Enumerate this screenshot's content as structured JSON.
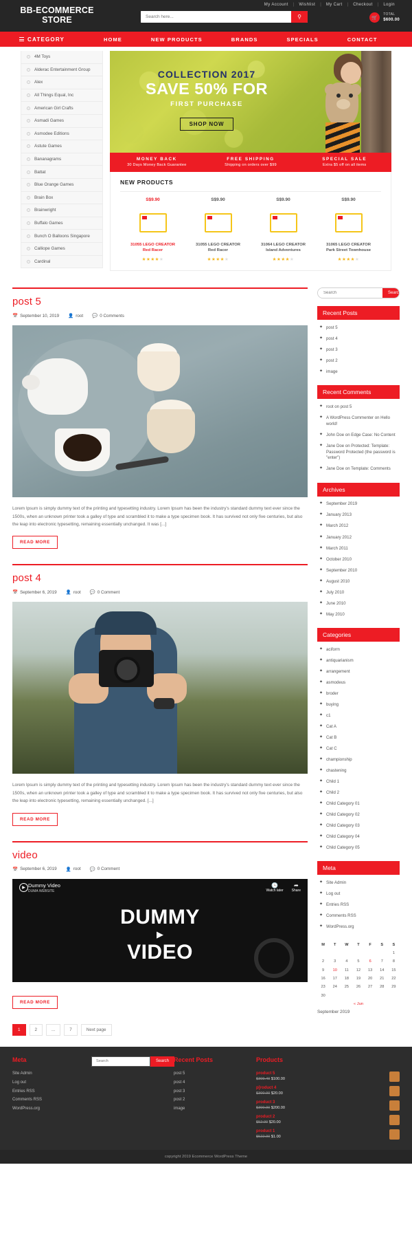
{
  "header": {
    "brand": "BB-ECOMMERCE STORE",
    "top_links": [
      "My Account",
      "Wishlist",
      "My Cart",
      "Checkout",
      "Login"
    ],
    "search_placeholder": "Search here...",
    "search_value": "",
    "search_icon": "search-icon",
    "cart_icon": "cart-icon",
    "cart_label": "TOTAL",
    "cart_total": "$600.00"
  },
  "nav": {
    "category_label": "CATEGORY",
    "items": [
      "HOME",
      "NEW PRODUCTS",
      "BRANDS",
      "SPECIALS",
      "CONTACT"
    ]
  },
  "categories": [
    "4M Toys",
    "Alderac Entertainment Group",
    "Alex",
    "All Things Equal, Inc",
    "American Girl Crafts",
    "Asmadi Games",
    "Asmodee Editions",
    "Astute Games",
    "Bananagrams",
    "Battat",
    "Blue Orange Games",
    "Brain Box",
    "Brainwright",
    "Buffalo Games",
    "Bunch O Balloons Singapore",
    "Calliope Games",
    "Cardinal"
  ],
  "banner": {
    "line1": "COLLECTION 2017",
    "line2": "SAVE 50% FOR",
    "line3": "FIRST PURCHASE",
    "cta": "SHOP NOW"
  },
  "promos": [
    {
      "title": "MONEY BACK",
      "sub": "30 Days Money Back Guarantee"
    },
    {
      "title": "FREE SHIPPING",
      "sub": "Shipping on orders over $99"
    },
    {
      "title": "SPECIAL SALE",
      "sub": "Extra $5 off on all items"
    }
  ],
  "new_products": {
    "heading": "NEW PRODUCTS",
    "items": [
      {
        "price": "S$9.90",
        "sale": true,
        "name_line1": "31055 LEGO CREATOR",
        "name_line2": "Red Racer",
        "rating": 4
      },
      {
        "price": "S$9.90",
        "sale": false,
        "name_line1": "31055 LEGO CREATOR",
        "name_line2": "Red Racer",
        "rating": 4
      },
      {
        "price": "S$9.90",
        "sale": false,
        "name_line1": "31064 LEGO CREATOR",
        "name_line2": "Island Adventures",
        "rating": 4
      },
      {
        "price": "S$9.90",
        "sale": false,
        "name_line1": "31065 LEGO CREATOR",
        "name_line2": "Park Street Townhouse",
        "rating": 4
      }
    ]
  },
  "posts": [
    {
      "title": "post 5",
      "date": "September 10, 2019",
      "author": "root",
      "comments": "0 Comments",
      "excerpt": "Lorem Ipsum is simply dummy text of the printing and typesetting industry. Lorem Ipsum has been the industry's standard dummy text ever since the 1500s, when an unknown printer took a galley of type and scrambled it to make a type specimen book. It has survived not only five centuries, but also the leap into electronic typesetting, remaining essentially unchanged. It was [...]",
      "read_more": "READ MORE"
    },
    {
      "title": "post 4",
      "date": "September 6, 2019",
      "author": "root",
      "comments": "0 Comment",
      "excerpt": "Lorem Ipsum is simply dummy text of the printing and typesetting industry. Lorem Ipsum has been the industry's standard dummy text ever since the 1500s, when an unknown printer took a galley of type and scrambled it to make a type specimen book. It has survived not only five centuries, but also the leap into electronic typesetting, remaining essentially unchanged. [...]",
      "read_more": "READ MORE"
    },
    {
      "title": "video",
      "date": "September 6, 2019",
      "author": "root",
      "comments": "0 Comment",
      "read_more": "READ MORE"
    }
  ],
  "video": {
    "title": "Dummy Video",
    "channel": "DUMA WEBSITE",
    "watch_later": "Watch later",
    "share": "Share",
    "overlay_line1": "DUMMY",
    "overlay_line2": "VIDEO"
  },
  "pagination": [
    "1",
    "2",
    "...",
    "7",
    "Next page"
  ],
  "sidebar": {
    "search_placeholder": "Search",
    "search_button": "Search",
    "recent_posts": {
      "title": "Recent Posts",
      "items": [
        "post 5",
        "post 4",
        "post 3",
        "post 2",
        "image"
      ]
    },
    "recent_comments": {
      "title": "Recent Comments",
      "items": [
        "root on post 5",
        "A WordPress Commenter on Hello world!",
        "John Doe on Edge Case: No Content",
        "Jane Doe on Protected: Template: Password Protected (the password is \"enter\")",
        "Jane Doe on Template: Comments"
      ]
    },
    "archives": {
      "title": "Archives",
      "items": [
        "September 2019",
        "January 2013",
        "March 2012",
        "January 2012",
        "March 2011",
        "October 2010",
        "September 2010",
        "August 2010",
        "July 2010",
        "June 2010",
        "May 2010"
      ]
    },
    "categories": {
      "title": "Categories",
      "items": [
        "aciform",
        "antiquarianism",
        "arrangement",
        "asmodeus",
        "broder",
        "buying",
        "c1",
        "Cat A",
        "Cat B",
        "Cat C",
        "championship",
        "chastening",
        "Child 1",
        "Child 2",
        "Child Category 01",
        "Child Category 02",
        "Child Category 03",
        "Child Category 04",
        "Child Category 05"
      ]
    },
    "meta": {
      "title": "Meta",
      "items": [
        "Site Admin",
        "Log out",
        "Entries RSS",
        "Comments RSS",
        "WordPress.org"
      ]
    },
    "calendar": {
      "weekdays": [
        "M",
        "T",
        "W",
        "T",
        "F",
        "S",
        "S"
      ],
      "weeks": [
        [
          "",
          "",
          "",
          "",
          "",
          "",
          "1"
        ],
        [
          "2",
          "3",
          "4",
          "5",
          "6",
          "7",
          "8"
        ],
        [
          "9",
          "10",
          "11",
          "12",
          "13",
          "14",
          "15"
        ],
        [
          "16",
          "17",
          "18",
          "19",
          "20",
          "21",
          "22"
        ],
        [
          "23",
          "24",
          "25",
          "26",
          "27",
          "28",
          "29"
        ],
        [
          "30",
          "",
          "",
          "",
          "",
          "",
          ""
        ]
      ],
      "highlight": [
        "10",
        "6"
      ],
      "nav_prev": "« Jun",
      "caption": "September 2019"
    }
  },
  "footer": {
    "meta": {
      "title": "Meta",
      "items": [
        "Site Admin",
        "Log out",
        "Entries RSS",
        "Comments RSS",
        "WordPress.org"
      ]
    },
    "search": {
      "placeholder": "Search",
      "button": "Search"
    },
    "recent_posts": {
      "title": "Recent Posts",
      "items": [
        "post 5",
        "post 4",
        "post 3",
        "post 2",
        "image"
      ]
    },
    "products": {
      "title": "Products",
      "items": [
        {
          "name": "product 5",
          "old": "$309.40",
          "new": "$100.00"
        },
        {
          "name": "p[roduct 4",
          "old": "$300.00",
          "new": "$20.00"
        },
        {
          "name": "product 3",
          "old": "$300.00",
          "new": "$200.00"
        },
        {
          "name": "product 2",
          "old": "$52.00",
          "new": "$20.00"
        },
        {
          "name": "product 1",
          "old": "$522.00",
          "new": "$1.00"
        }
      ]
    },
    "copyright": "copyright 2019 Ecommerce WordPress Theme"
  },
  "colors": {
    "accent": "#ed1c24",
    "dark": "#262626",
    "footer": "#2d2d2d"
  }
}
